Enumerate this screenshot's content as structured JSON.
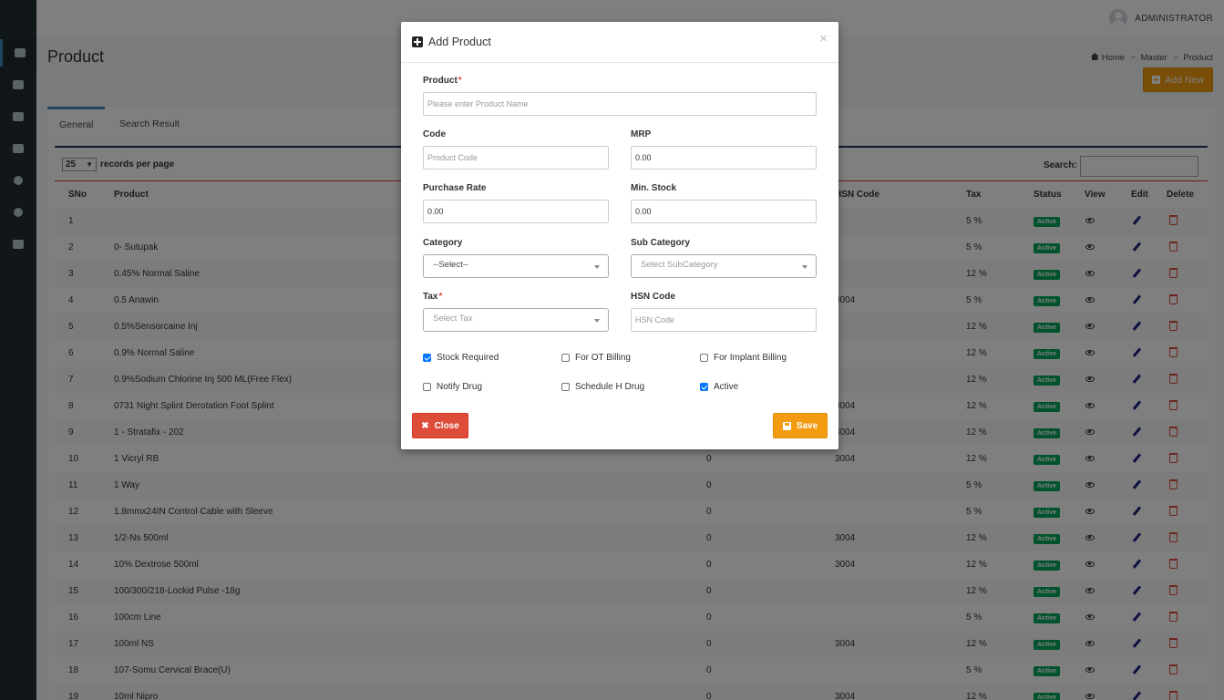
{
  "header": {
    "user": "ADMINISTRATOR"
  },
  "page": {
    "title": "Product",
    "breadcrumb": [
      "Home",
      "Master",
      "Product"
    ],
    "add_new_label": "Add New"
  },
  "tabs": [
    "General",
    "Search Result"
  ],
  "table": {
    "records_per_page_value": "25",
    "records_per_page_label": "records per page",
    "search_label": "Search:",
    "columns": [
      "SNo",
      "Product",
      "",
      "HSN Code",
      "Tax",
      "Status",
      "View",
      "Edit",
      "Delete"
    ],
    "rows": [
      {
        "sno": "1",
        "product": "",
        "stock": "",
        "hsn": "",
        "tax": "5 %",
        "status": "Active"
      },
      {
        "sno": "2",
        "product": "0- Sutupak",
        "stock": "",
        "hsn": "",
        "tax": "5 %",
        "status": "Active"
      },
      {
        "sno": "3",
        "product": "0.45% Normal Saline",
        "stock": "",
        "hsn": "",
        "tax": "12 %",
        "status": "Active"
      },
      {
        "sno": "4",
        "product": "0.5 Anawin",
        "stock": "",
        "hsn": "3004",
        "tax": "5 %",
        "status": "Active"
      },
      {
        "sno": "5",
        "product": "0.5%Sensorcaine Inj",
        "stock": "",
        "hsn": "",
        "tax": "12 %",
        "status": "Active"
      },
      {
        "sno": "6",
        "product": "0.9% Normal Saline",
        "stock": "",
        "hsn": "",
        "tax": "12 %",
        "status": "Active"
      },
      {
        "sno": "7",
        "product": "0.9%Sodium Chlorine Inj 500 ML(Free Flex)",
        "stock": "",
        "hsn": "",
        "tax": "12 %",
        "status": "Active"
      },
      {
        "sno": "8",
        "product": "0731 Night Splint Derotation Foot Splint",
        "stock": "",
        "hsn": "3004",
        "tax": "12 %",
        "status": "Active"
      },
      {
        "sno": "9",
        "product": "1 - Stratafix - 202",
        "stock": "",
        "hsn": "3004",
        "tax": "12 %",
        "status": "Active"
      },
      {
        "sno": "10",
        "product": "1 Vicryl RB",
        "stock": "0",
        "hsn": "3004",
        "tax": "12 %",
        "status": "Active"
      },
      {
        "sno": "11",
        "product": "1 Way",
        "stock": "0",
        "hsn": "",
        "tax": "5 %",
        "status": "Active"
      },
      {
        "sno": "12",
        "product": "1.8mmx24IN Control Cable with Sleeve",
        "stock": "0",
        "hsn": "",
        "tax": "5 %",
        "status": "Active"
      },
      {
        "sno": "13",
        "product": "1/2-Ns 500ml",
        "stock": "0",
        "hsn": "3004",
        "tax": "12 %",
        "status": "Active"
      },
      {
        "sno": "14",
        "product": "10% Dextrose 500ml",
        "stock": "0",
        "hsn": "3004",
        "tax": "12 %",
        "status": "Active"
      },
      {
        "sno": "15",
        "product": "100/300/218-Lockid Pulse -18g",
        "stock": "0",
        "hsn": "",
        "tax": "12 %",
        "status": "Active"
      },
      {
        "sno": "16",
        "product": "100cm Line",
        "stock": "0",
        "hsn": "",
        "tax": "5 %",
        "status": "Active"
      },
      {
        "sno": "17",
        "product": "100ml NS",
        "stock": "0",
        "hsn": "3004",
        "tax": "12 %",
        "status": "Active"
      },
      {
        "sno": "18",
        "product": "107-Somu Cervical Brace(U)",
        "stock": "0",
        "hsn": "",
        "tax": "5 %",
        "status": "Active"
      },
      {
        "sno": "19",
        "product": "10ml Nipro",
        "stock": "0",
        "hsn": "3004",
        "tax": "12 %",
        "status": "Active"
      }
    ]
  },
  "modal": {
    "title": "Add Product",
    "close_glyph": "×",
    "product_label": "Product",
    "product_placeholder": "Please enter Product Name",
    "code_label": "Code",
    "code_placeholder": "Product Code",
    "mrp_label": "MRP",
    "mrp_value": "0.00",
    "purchase_rate_label": "Purchase Rate",
    "purchase_rate_value": "0.00",
    "min_stock_label": "Min. Stock",
    "min_stock_value": "0.00",
    "category_label": "Category",
    "category_value": "--Select--",
    "subcategory_label": "Sub Category",
    "subcategory_placeholder": "Select SubCategory",
    "tax_label": "Tax",
    "tax_placeholder": "Select Tax",
    "hsn_label": "HSN Code",
    "hsn_placeholder": "HSN Code",
    "required_mark": "*",
    "checkboxes": [
      {
        "label": "Stock Required",
        "checked": true
      },
      {
        "label": "For OT Billing",
        "checked": false
      },
      {
        "label": "For Implant Billing",
        "checked": false
      },
      {
        "label": "Notify Drug",
        "checked": false
      },
      {
        "label": "Schedule H Drug",
        "checked": false
      },
      {
        "label": "Active",
        "checked": true
      }
    ],
    "close_button": "Close",
    "save_button": "Save"
  },
  "colors": {
    "sidebar": "#222d32",
    "accent": "#3c8dbc",
    "warning": "#f39c12",
    "danger": "#dd4b39",
    "success": "#00a65a"
  }
}
